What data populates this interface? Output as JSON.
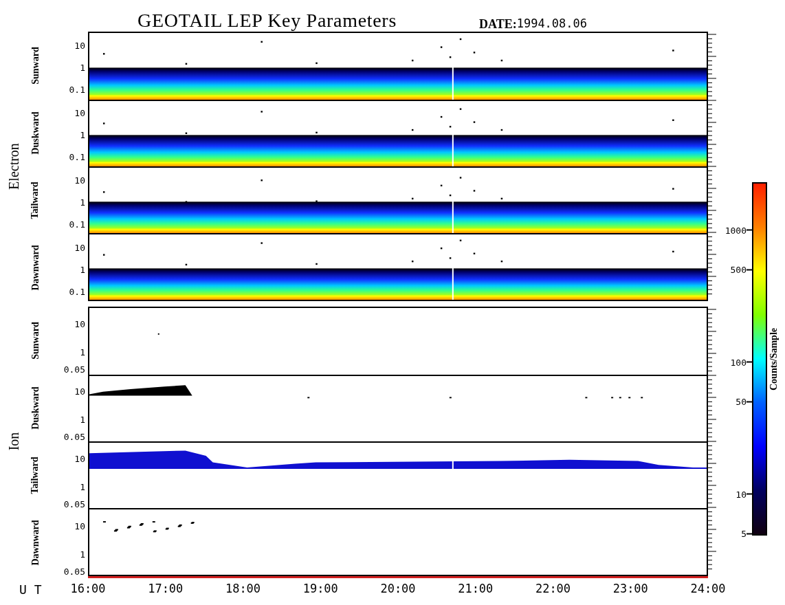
{
  "title": "GEOTAIL LEP Key Parameters",
  "date": {
    "label": "DATE:",
    "value": "1994.08.06"
  },
  "groups": [
    {
      "name": "Electron",
      "kind": "electron",
      "panels": [
        {
          "label": "Sunward",
          "yticks": [
            "10",
            "1",
            "0.1"
          ],
          "kind": "spectrum"
        },
        {
          "label": "Duskward",
          "yticks": [
            "10",
            "1",
            "0.1"
          ],
          "kind": "spectrum"
        },
        {
          "label": "Tailward",
          "yticks": [
            "10",
            "1",
            "0.1"
          ],
          "kind": "spectrum"
        },
        {
          "label": "Dawnward",
          "yticks": [
            "10",
            "1",
            "0.1"
          ],
          "kind": "spectrum"
        }
      ]
    },
    {
      "name": "Ion",
      "kind": "ion",
      "panels": [
        {
          "label": "Sunward",
          "yticks": [
            "10",
            "1",
            "0.05"
          ],
          "kind": "empty"
        },
        {
          "label": "Duskward",
          "yticks": [
            "10",
            "1",
            "0.05"
          ],
          "kind": "patchy"
        },
        {
          "label": "Tailward",
          "yticks": [
            "10",
            "1",
            "0.05"
          ],
          "kind": "band"
        },
        {
          "label": "Dawnward",
          "yticks": [
            "10",
            "1",
            "0.05"
          ],
          "kind": "speckled"
        }
      ]
    }
  ],
  "x_axis": {
    "label": "U T",
    "ticks": [
      "16:00",
      "17:00",
      "18:00",
      "19:00",
      "20:00",
      "21:00",
      "22:00",
      "23:00",
      "24:00"
    ]
  },
  "colorbar": {
    "label": "Counts/Sample",
    "ticks": [
      "1000",
      "500",
      "100",
      "50",
      "10",
      "5"
    ]
  }
}
